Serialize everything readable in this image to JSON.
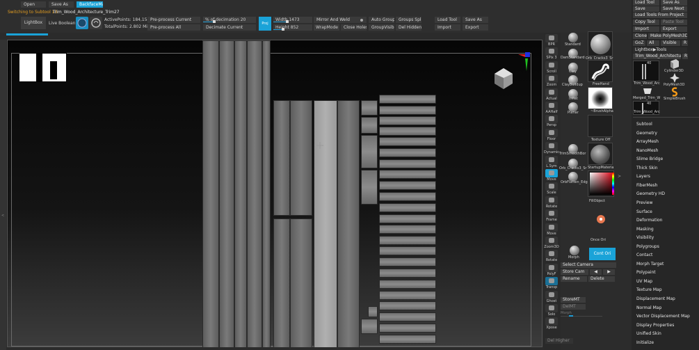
{
  "top": {
    "open": "Open",
    "save_as": "Save As",
    "backface_mask": "BackfaceMask",
    "status": "Switching to Subtool 13:",
    "subtool_name": "Trim_Wood_Architecture_Trim27",
    "lightbox": "LightBox",
    "live_boolean": "Live Boolean",
    "active_points_label": "ActivePoints:",
    "active_points": "184,154",
    "total_points_label": "TotalPoints:",
    "total_points": "2.802 Mil",
    "preprocess_current": "Pre-process Current",
    "preprocess_all": "Pre-process All",
    "pct_decimation_label": "% of decimation",
    "pct_decimation": "20",
    "decimate_current": "Decimate Current",
    "proj": "Proj",
    "width_label": "Width",
    "width": "1473",
    "height_label": "Height",
    "height": "852",
    "mirror_weld": "Mirror And Weld",
    "wrapmode_label": "WrapMode",
    "wrapmode": "0",
    "close_holes": "Close Holes",
    "auto_groups": "Auto Groups",
    "groups_split": "Groups Split",
    "group_visible": "GroupVisible",
    "del_hidden": "Del Hidden",
    "load_tool": "Load Tool",
    "save_as2": "Save As",
    "import": "Import",
    "export": "Export"
  },
  "shelf": {
    "items": [
      "BPR",
      "SPix 3",
      "Scroll",
      "Zoom",
      "Actual",
      "AAHalf",
      "Persp",
      "Floor",
      "Dynamic",
      "L.Sym",
      "Move",
      "Scale",
      "Rotate",
      "Frame",
      "Move",
      "Zoom3D",
      "Rotate",
      "PolyF",
      "Transp",
      "Ghost",
      "Solo",
      "Xpose"
    ]
  },
  "materials": {
    "standard": "Standard",
    "damstandard": "DamStandard",
    "clay": "Clay",
    "claybuildup": "ClayBuildup",
    "inflat": "Inflat",
    "planar": "Planar",
    "trimsmooth": "TrimSmoothBor",
    "orb_cracks": "Orb_Cracks3_Sr",
    "orbflatten": "OrbFlatten_Edg",
    "morph": "Morph",
    "brush_tile": "Orb_Cracks3_Sr",
    "freehand": "FreeHand",
    "brushalpha": "~BrushAlpha",
    "texture_off": "Texture Off",
    "startup_material": "StartupMateria",
    "fill_object": "FillObject",
    "once_ori": "Once Ori",
    "cont_ori": "Cont Ori",
    "select_camera": "Select Camera",
    "store_cam": "Store Cam",
    "rename": "Rename",
    "delete": "Delete",
    "storemt": "StoreMT",
    "delmt": "DelMT",
    "morph_slider": "Morph",
    "del_higher": "Del Higher"
  },
  "right": {
    "load_tool": "Load Tool",
    "save_as": "Save As",
    "save": "Save",
    "save_next": "Save Next",
    "load_from_project": "Load Tools From Project",
    "copy_tool": "Copy Tool",
    "paste_tool": "Paste Tool",
    "import": "Import",
    "export": "Export",
    "clone": "Clone",
    "make_polymesh": "Make PolyMesh3D",
    "goz": "GoZ",
    "all": "All",
    "visible": "Visible",
    "r": "R",
    "lightbox_tools": "Lightbox▶Tools",
    "current_tool": "Trim_Wood_Architecture_T",
    "tool_count_a": "40",
    "tool_count_b": "40",
    "tool1": "Trim_Wood_Arc",
    "tool2": "Cylinder3D",
    "tool3": "Merged_Trim_W",
    "tool4": "PolyMesh3D",
    "tool5": "Trim_Wood_Arc",
    "tool6": "SimpleBrush",
    "menu": [
      "Subtool",
      "Geometry",
      "ArrayMesh",
      "NanoMesh",
      "Slime Bridge",
      "Thick Skin",
      "Layers",
      "FiberMesh",
      "Geometry HD",
      "Preview",
      "Surface",
      "Deformation",
      "Masking",
      "Visibility",
      "Polygroups",
      "Contact",
      "Morph Target",
      "Polypaint",
      "UV Map",
      "Texture Map",
      "Displacement Map",
      "Normal Map",
      "Vector Displacement Map",
      "Display Properties",
      "Unified Skin",
      "Initialize"
    ]
  }
}
